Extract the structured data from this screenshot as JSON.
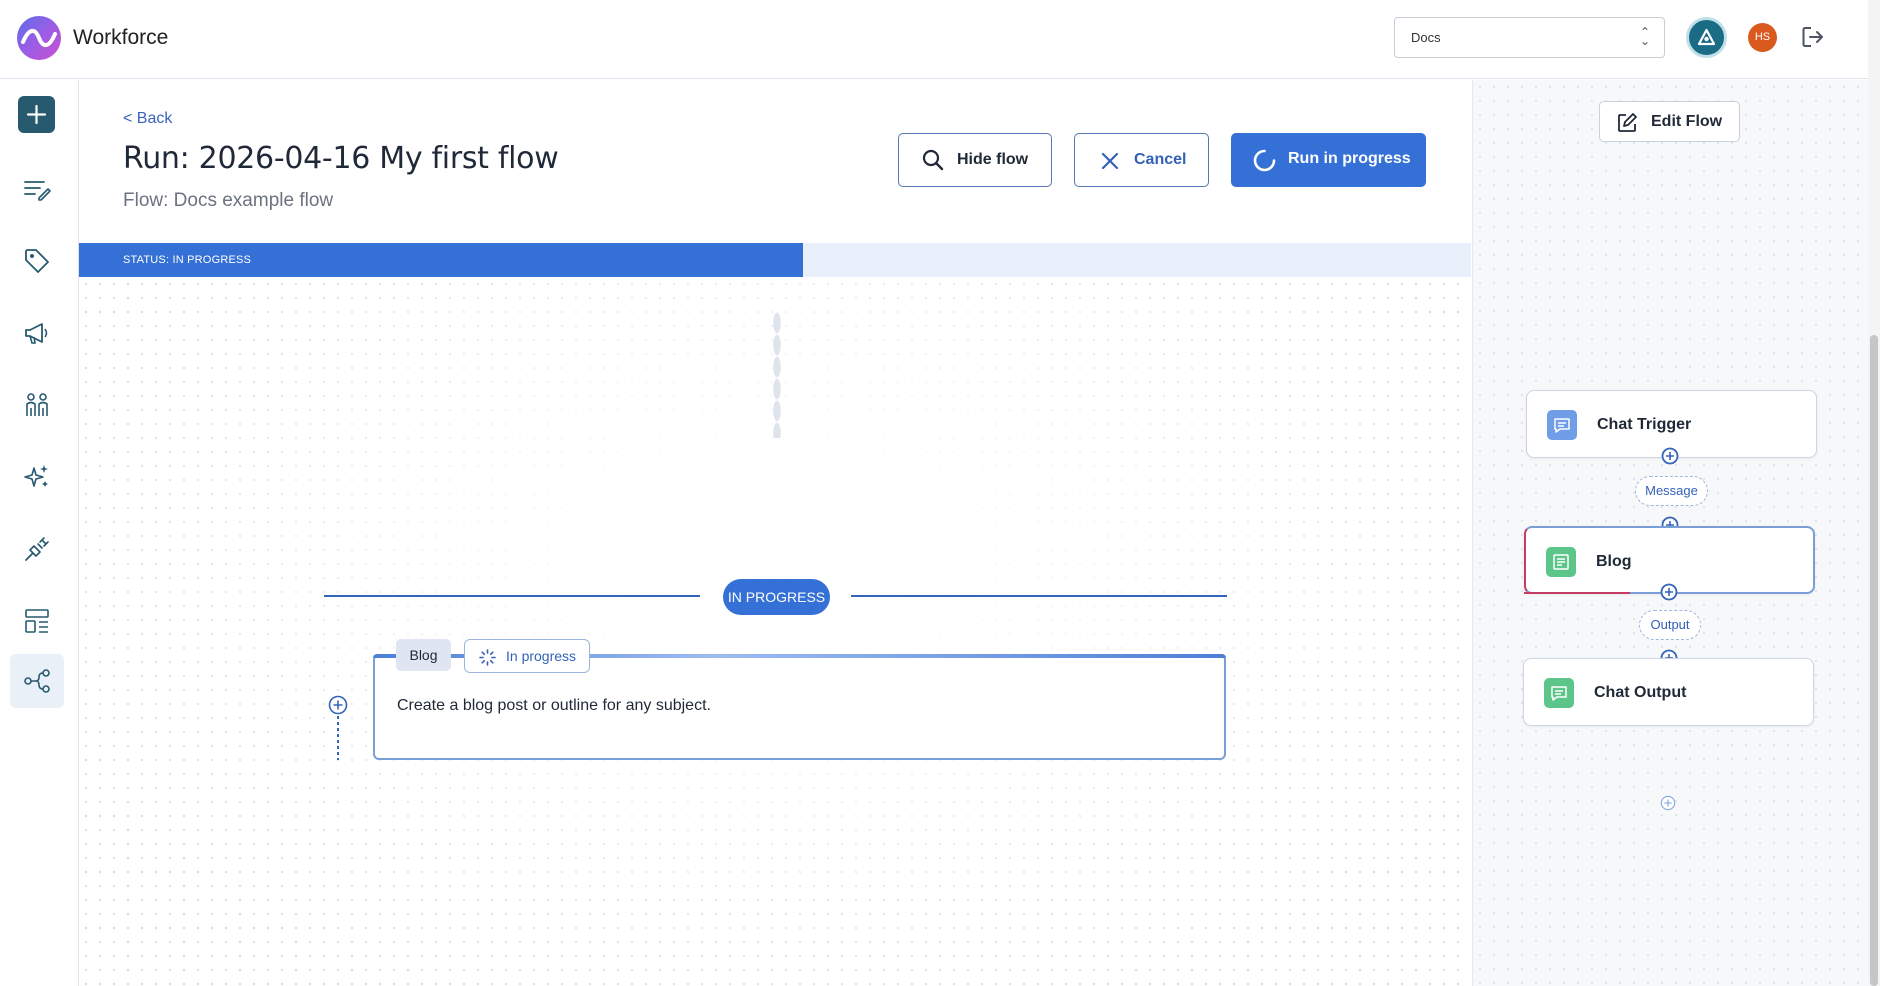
{
  "app": {
    "title": "Workforce"
  },
  "header": {
    "workspace_value": "Docs",
    "avatar_initials": "HS"
  },
  "main": {
    "back_label": "< Back",
    "run_title": "Run: 2026-04-16 My first flow",
    "flow_subtitle": "Flow: Docs example flow",
    "buttons": {
      "hide_flow": "Hide flow",
      "cancel": "Cancel",
      "run_in_progress": "Run in progress"
    },
    "status_text": "STATUS: IN PROGRESS",
    "progress_fraction": 0.52,
    "stage_pill": "IN PROGRESS",
    "step": {
      "tag": "Blog",
      "state": "In progress",
      "description": "Create a blog post or outline for any subject."
    }
  },
  "right_panel": {
    "edit_flow_label": "Edit Flow",
    "nodes": [
      {
        "label": "Chat Trigger",
        "icon": "chat-icon"
      },
      {
        "label": "Blog",
        "icon": "document-icon"
      },
      {
        "label": "Chat Output",
        "icon": "chat-icon"
      }
    ],
    "edges": [
      "Message",
      "Output"
    ]
  },
  "sidebar": {
    "items": [
      "add",
      "list-edit",
      "tag",
      "megaphone",
      "people",
      "sparkles",
      "plug",
      "layout",
      "flow"
    ],
    "active": "flow"
  },
  "colors": {
    "accent": "#3570d6",
    "brand_dark": "#275a6f",
    "active_node_edge": "#c63b63",
    "avatar": "#d9591f"
  }
}
